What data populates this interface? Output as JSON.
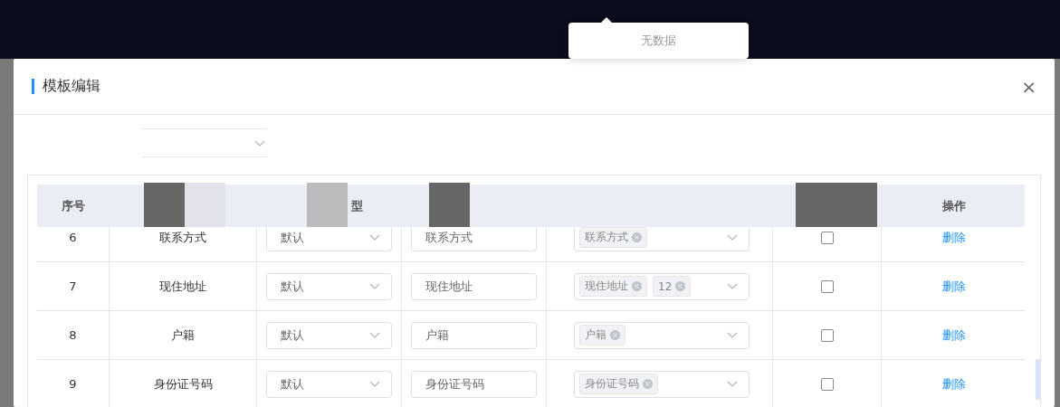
{
  "popover": {
    "text": "无数据"
  },
  "dialog": {
    "title": "模板编辑",
    "close": "×"
  },
  "table": {
    "header": {
      "column_1": "序号",
      "column_3": "型",
      "column_7": "操作"
    },
    "rows": [
      {
        "index": "6",
        "name": "联系方式",
        "type": "默认",
        "label": "联系方式",
        "tags": [
          "联系方式"
        ],
        "checked": false,
        "action": "删除"
      },
      {
        "index": "7",
        "name": "现住地址",
        "type": "默认",
        "label": "现住地址",
        "tags": [
          "现住地址",
          "12"
        ],
        "checked": false,
        "action": "删除"
      },
      {
        "index": "8",
        "name": "户籍",
        "type": "默认",
        "label": "户籍",
        "tags": [
          "户籍"
        ],
        "checked": false,
        "action": "删除"
      },
      {
        "index": "9",
        "name": "身份证号码",
        "type": "默认",
        "label": "身份证号码",
        "tags": [
          "身份证号码"
        ],
        "checked": false,
        "action": "删除"
      }
    ]
  }
}
